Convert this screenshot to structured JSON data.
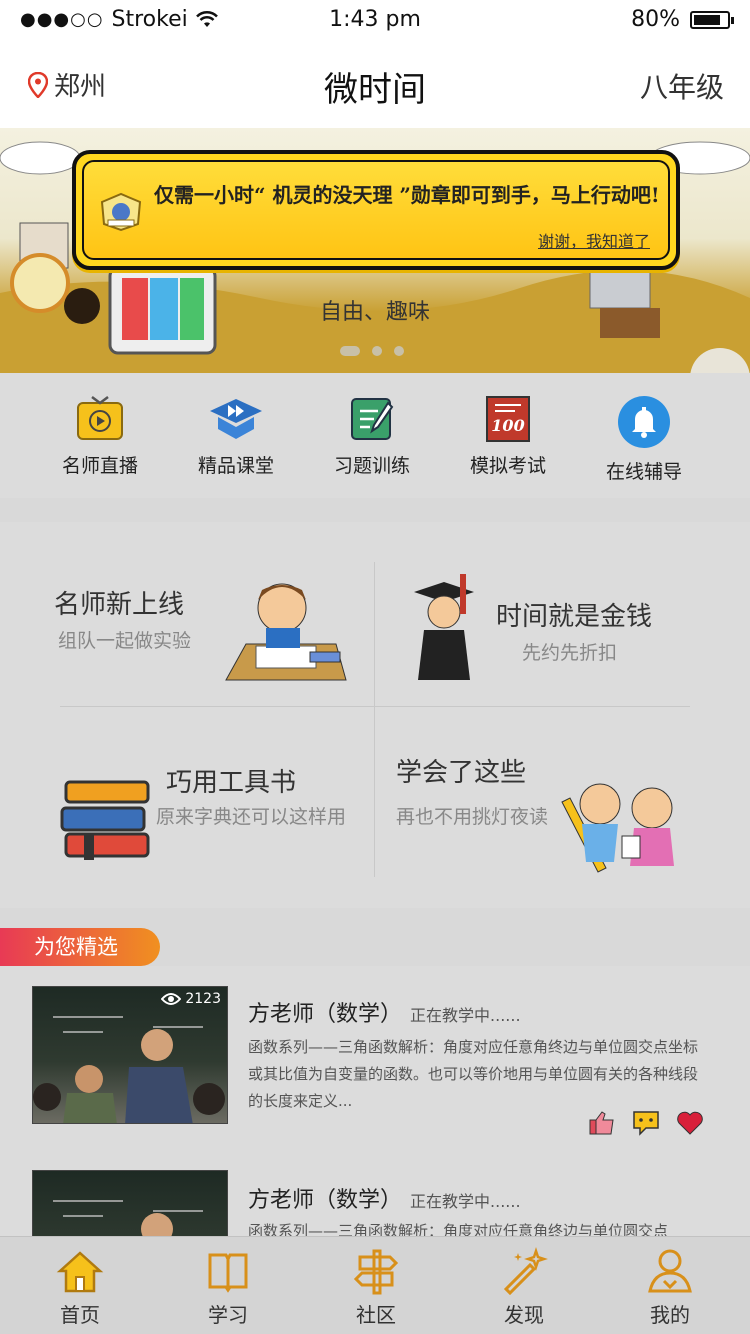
{
  "status": {
    "carrier": "Strokei",
    "time": "1:43 pm",
    "battery": "80%",
    "battery_level": 0.8
  },
  "nav": {
    "city": "郑州",
    "title": "微时间",
    "grade": "八年级"
  },
  "banner": {
    "subtitle": "自由、趣味",
    "dots": 3,
    "active_dot": 0
  },
  "toast": {
    "message": "仅需一小时“ 机灵的没天理 ”勋章即可到手，马上行动吧!",
    "dismiss": "谢谢，我知道了"
  },
  "quick_menu": [
    {
      "label": "名师直播",
      "icon": "tv-play-icon"
    },
    {
      "label": "精品课堂",
      "icon": "class-forward-icon"
    },
    {
      "label": "习题训练",
      "icon": "exercise-edit-icon"
    },
    {
      "label": "模拟考试",
      "icon": "score-100-icon"
    },
    {
      "label": "在线辅导",
      "icon": "bell-icon"
    }
  ],
  "features": [
    {
      "title": "名师新上线",
      "subtitle": "组队一起做实验"
    },
    {
      "title": "时间就是金钱",
      "subtitle": "先约先折扣"
    },
    {
      "title": "巧用工具书",
      "subtitle": "原来字典还可以这样用"
    },
    {
      "title": "学会了这些",
      "subtitle": "再也不用挑灯夜读"
    }
  ],
  "section_label": "为您精选",
  "list": [
    {
      "title": "方老师（数学）",
      "status": "正在教学中......",
      "views": "2123",
      "description": "函数系列——三角函数解析：角度对应任意角终边与单位圆交点坐标或其比值为自变量的函数。也可以等价地用与单位圆有关的各种线段的长度来定义..."
    },
    {
      "title": "方老师（数学）",
      "status": "正在教学中......",
      "views": "",
      "description": "函数系列——三角函数解析：角度对应任意角终边与单位圆交点"
    }
  ],
  "tabs": [
    {
      "label": "首页",
      "icon": "home-icon"
    },
    {
      "label": "学习",
      "icon": "book-icon"
    },
    {
      "label": "社区",
      "icon": "signpost-icon"
    },
    {
      "label": "发现",
      "icon": "magic-wand-icon"
    },
    {
      "label": "我的",
      "icon": "user-icon"
    }
  ],
  "colors": {
    "accent": "#f0a020",
    "toast": "#ffd71f",
    "section_start": "#e83a55",
    "section_end": "#f09020"
  }
}
